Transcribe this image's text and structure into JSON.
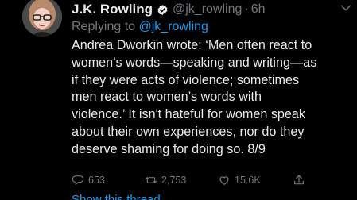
{
  "tweet": {
    "author": {
      "display_name": "J.K. Rowling",
      "handle": "@jk_rowling",
      "verified": true
    },
    "separator": "·",
    "time": "6h",
    "replying_prefix": "Replying to ",
    "replying_handle": "@jk_rowling",
    "text_lines": [
      "Andrea Dworkin wrote: ‘Men often react to",
      "women’s words—speaking and writing—as",
      "if they were acts of violence; sometimes",
      "men react to women’s words with",
      "violence.’ It isn't hateful for women speak",
      "about their own experiences, nor do they",
      "deserve shaming for doing so. 8/9"
    ],
    "stats": {
      "replies": "653",
      "retweets": "2,753",
      "likes": "15.6K"
    },
    "show_thread_label": "Show this thread"
  },
  "icons": {
    "verified": "verified-badge-icon",
    "menu": "chevron-down-icon",
    "reply": "reply-icon",
    "retweet": "retweet-icon",
    "like": "heart-icon",
    "share": "share-icon"
  },
  "colors": {
    "background": "#000000",
    "text": "#e7e9ea",
    "muted": "#71767b",
    "accent": "#1d9bf0"
  }
}
